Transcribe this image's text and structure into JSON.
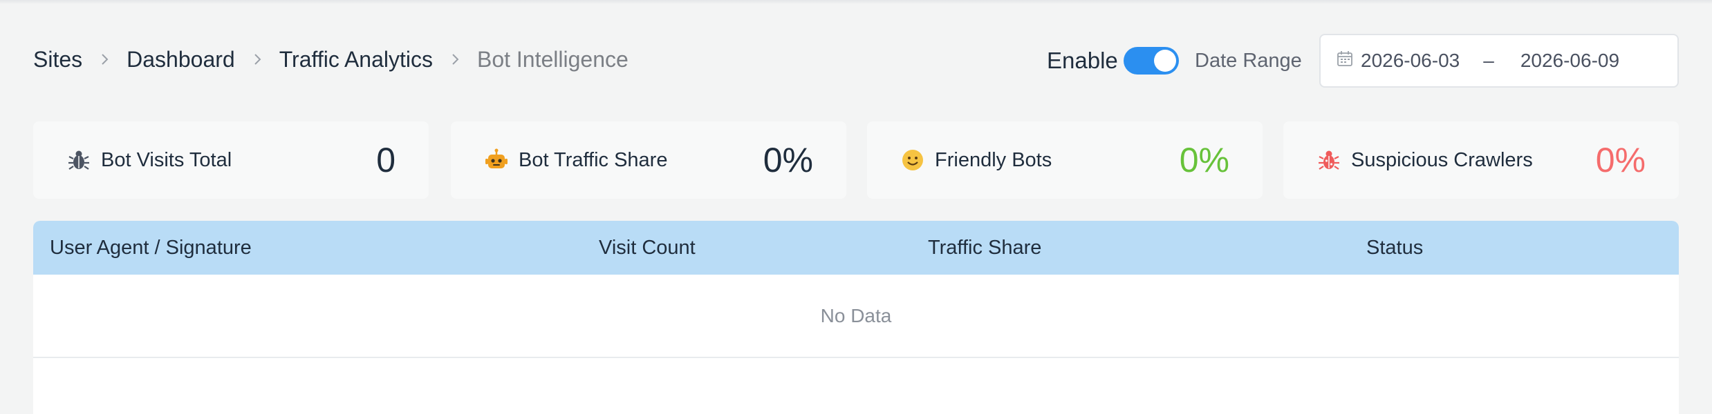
{
  "breadcrumb": {
    "items": [
      "Sites",
      "Dashboard",
      "Traffic Analytics",
      "Bot Intelligence"
    ]
  },
  "controls": {
    "enable_label": "Enable",
    "enable_on": true,
    "date_range_label": "Date Range",
    "date_start": "2026-06-03",
    "date_separator": "–",
    "date_end": "2026-06-09"
  },
  "stats": [
    {
      "icon": "bug-icon",
      "label": "Bot Visits Total",
      "value": "0",
      "color": "#1f2d3d"
    },
    {
      "icon": "robot-icon",
      "label": "Bot Traffic Share",
      "value": "0%",
      "color": "#1f2d3d"
    },
    {
      "icon": "smiley-icon",
      "label": "Friendly Bots",
      "value": "0%",
      "color": "#67c23a"
    },
    {
      "icon": "red-bug-icon",
      "label": "Suspicious Crawlers",
      "value": "0%",
      "color": "#f56c6c"
    }
  ],
  "table": {
    "columns": [
      "User Agent / Signature",
      "Visit Count",
      "Traffic Share",
      "Status"
    ],
    "empty_text": "No Data"
  },
  "colors": {
    "accent": "#2b8ff0",
    "header_bg": "#b9dcf6",
    "friendly": "#67c23a",
    "suspicious": "#f56c6c"
  }
}
